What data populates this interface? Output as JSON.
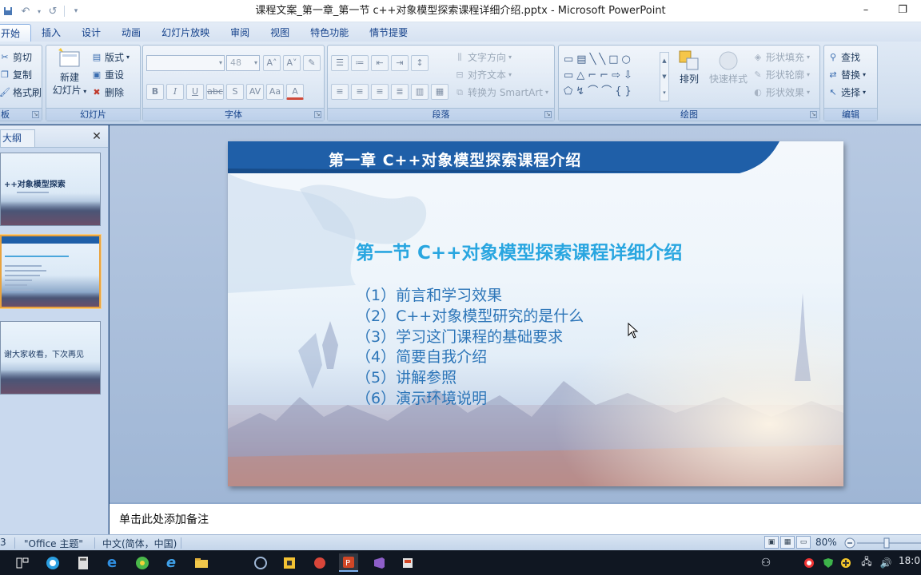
{
  "window": {
    "title": "课程文案_第一章_第一节 c++对象模型探索课程详细介绍.pptx - Microsoft PowerPoint",
    "controls": [
      "–",
      "❐"
    ]
  },
  "quick_access": [
    "save-icon",
    "undo-icon",
    "redo-icon",
    "customize-icon"
  ],
  "ribbon_tabs": [
    "开始",
    "插入",
    "设计",
    "动画",
    "幻灯片放映",
    "审阅",
    "视图",
    "特色功能",
    "情节提要"
  ],
  "ribbon": {
    "clipboard": {
      "label": "板",
      "cut": "剪切",
      "copy": "复制",
      "format_painter": "格式刷"
    },
    "slides": {
      "label": "幻灯片",
      "new_slide_line1": "新建",
      "new_slide_line2": "幻灯片",
      "layout": "版式",
      "reset": "重设",
      "delete": "删除"
    },
    "font": {
      "label": "字体",
      "font_size": "48",
      "font_name": ""
    },
    "paragraph": {
      "label": "段落",
      "text_direction": "文字方向",
      "align_text": "对齐文本",
      "convert_smartart": "转换为 SmartArt"
    },
    "drawing": {
      "label": "绘图",
      "arrange": "排列",
      "quick_styles": "快速样式",
      "shape_fill": "形状填充",
      "shape_outline": "形状轮廓",
      "shape_effects": "形状效果"
    },
    "editing": {
      "label": "编辑",
      "find": "查找",
      "replace": "替换",
      "select": "选择"
    }
  },
  "left_panel": {
    "tab_outline": "大纲",
    "thumbnails": [
      {
        "text": "++对象模型探索",
        "selected": false
      },
      {
        "text": "",
        "selected": true
      },
      {
        "text": "谢大家收看，下次再见",
        "selected": false
      }
    ]
  },
  "slide": {
    "header": "第一章  C++对象模型探索课程介绍",
    "subtitle": "第一节 C++对象模型探索课程详细介绍",
    "items": [
      "（1）前言和学习效果",
      "（2）C++对象模型研究的是什么",
      "（3）学习这门课程的基础要求",
      "（4）简要自我介绍",
      "（5）讲解参照",
      "（6）演示环境说明"
    ]
  },
  "notes": {
    "placeholder": "单击此处添加备注"
  },
  "status_bar": {
    "slide_indicator": "3",
    "theme": "\"Office 主题\"",
    "language": "中文(简体，中国)",
    "zoom": "80%"
  },
  "taskbar": {
    "clock": "18:0"
  },
  "colors": {
    "header_blue": "#1f5fa8",
    "subtitle_cyan": "#29a6e0",
    "list_blue": "#2c75b8"
  }
}
